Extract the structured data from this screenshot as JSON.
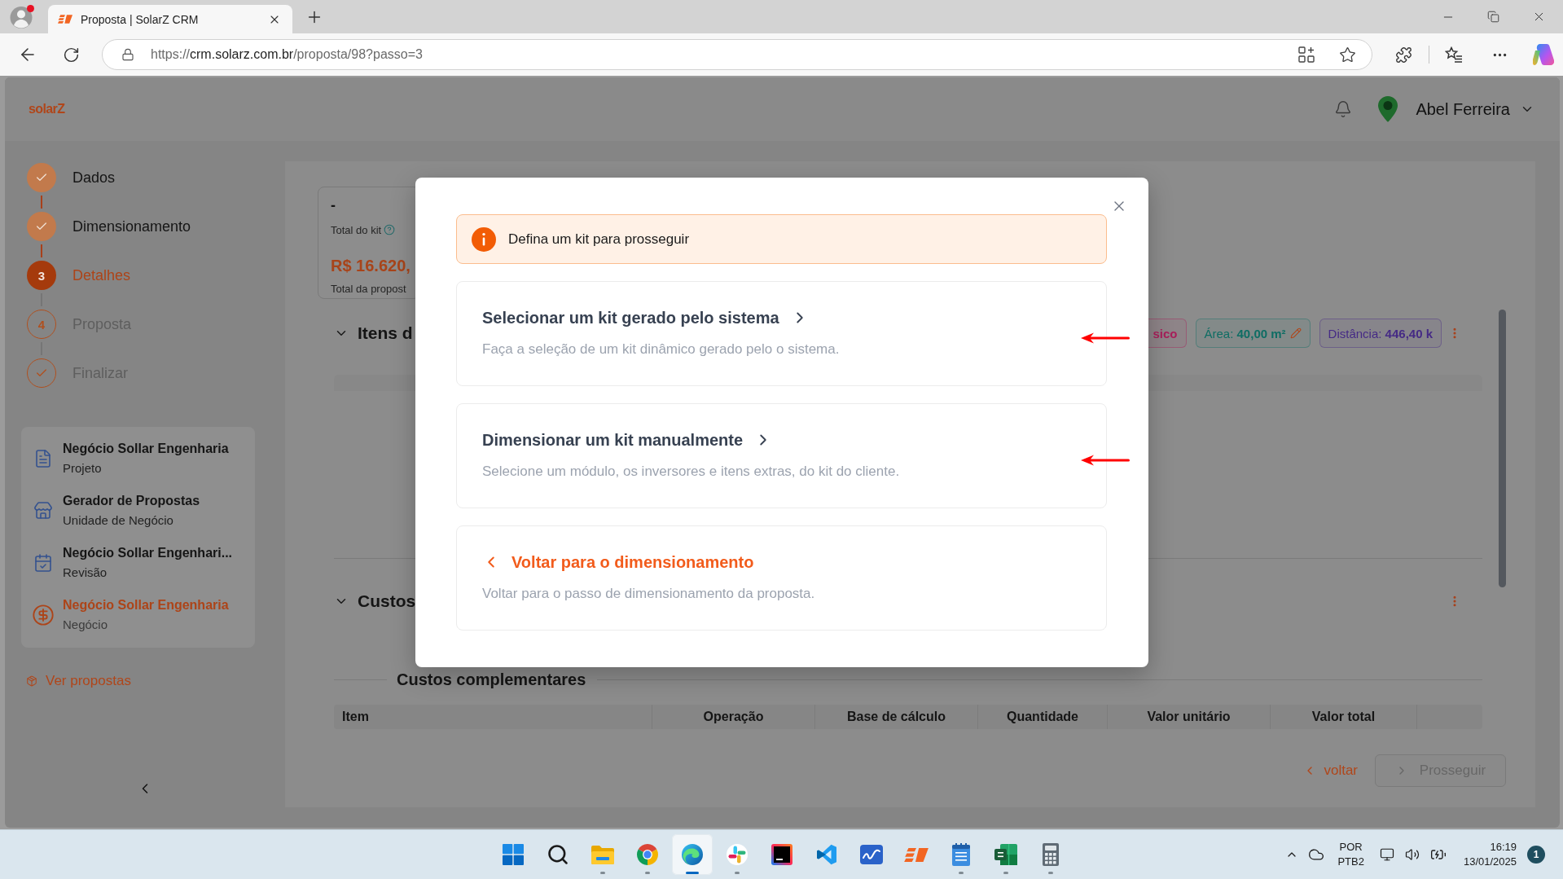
{
  "browser": {
    "tab": {
      "title": "Proposta | SolarZ CRM"
    },
    "url": {
      "scheme": "https://",
      "host": "crm.solarz.com.br",
      "path": "/proposta/98?passo=3"
    }
  },
  "header": {
    "logo": "solarZ",
    "user_name": "Abel Ferreira"
  },
  "steps": [
    {
      "label": "Dados",
      "completed": true,
      "current": false
    },
    {
      "label": "Dimensionamento",
      "completed": true,
      "current": false
    },
    {
      "label": "Detalhes",
      "completed": false,
      "current": true,
      "number": "3"
    },
    {
      "label": "Proposta",
      "completed": false,
      "current": false,
      "number": "4"
    },
    {
      "label": "Finalizar",
      "completed": false,
      "current": false
    }
  ],
  "context_items": [
    {
      "kind": "document",
      "title": "Negócio Sollar Engenharia",
      "subtitle": "Projeto",
      "selected": false
    },
    {
      "kind": "store",
      "title": "Gerador de Propostas",
      "subtitle": "Unidade de Negócio",
      "selected": false
    },
    {
      "kind": "calendar",
      "title": "Negócio Sollar Engenhari...",
      "subtitle": "Revisão",
      "selected": false
    },
    {
      "kind": "money",
      "title": "Negócio Sollar Engenharia",
      "subtitle": "Negócio",
      "selected": true
    }
  ],
  "proposals_link": "Ver propostas",
  "summary": {
    "value": "-",
    "value_label": "Total do kit",
    "total": "R$ 16.620,",
    "total_label": "Total da propost"
  },
  "sections": [
    {
      "kind": "items",
      "title": "Itens d",
      "expanded": true,
      "tags": [
        {
          "value": "sico",
          "color": "#a81f5a",
          "editable": false
        },
        {
          "label": "Área:",
          "value": "40,00 m²",
          "color": "#0f6d64",
          "editable": true
        },
        {
          "label": "Distância:",
          "value": "446,40 k",
          "color": "#452a85",
          "editable": false
        }
      ]
    },
    {
      "kind": "costs",
      "title": "Custos",
      "expanded": true,
      "subsection": {
        "title": "Custos complementares",
        "columns": [
          "Item",
          "Operação",
          "Base de cálculo",
          "Quantidade",
          "Valor unitário",
          "Valor total"
        ]
      }
    }
  ],
  "actions": {
    "back": "voltar",
    "next": {
      "label": "Prosseguir",
      "disabled": true
    }
  },
  "modal": {
    "alert": "Defina um kit para prosseguir",
    "options": [
      {
        "kind": "forward",
        "title": "Selecionar um kit gerado pelo sistema",
        "description": "Faça a seleção de um kit dinâmico gerado pelo o sistema.",
        "marked": true
      },
      {
        "kind": "forward",
        "title": "Dimensionar um kit manualmente",
        "description": "Selecione um módulo, os inversores e itens extras, do kit do cliente.",
        "marked": true
      },
      {
        "kind": "back",
        "title": "Voltar para o dimensionamento",
        "description": "Voltar para o passo de dimensionamento da proposta.",
        "marked": false
      }
    ]
  },
  "taskbar": {
    "apps": [
      {
        "kind": "start",
        "running": false,
        "active": false
      },
      {
        "kind": "search",
        "running": false,
        "active": false
      },
      {
        "kind": "folder",
        "running": true,
        "active": false
      },
      {
        "kind": "chrome",
        "running": true,
        "active": false
      },
      {
        "kind": "edge",
        "running": true,
        "active": true
      },
      {
        "kind": "slack",
        "running": true,
        "active": false
      },
      {
        "kind": "ide",
        "running": false,
        "active": false
      },
      {
        "kind": "vscode",
        "running": false,
        "active": false
      },
      {
        "kind": "whiteboard",
        "running": false,
        "active": false
      },
      {
        "kind": "solarz",
        "running": false,
        "active": false
      },
      {
        "kind": "notepad",
        "running": true,
        "active": false
      },
      {
        "kind": "excel",
        "running": true,
        "active": false
      },
      {
        "kind": "calculator",
        "running": true,
        "active": false
      }
    ],
    "tray": {
      "language": "POR",
      "layout": "PTB2",
      "time": "16:19",
      "date": "13/01/2025",
      "notifications": "1"
    }
  }
}
